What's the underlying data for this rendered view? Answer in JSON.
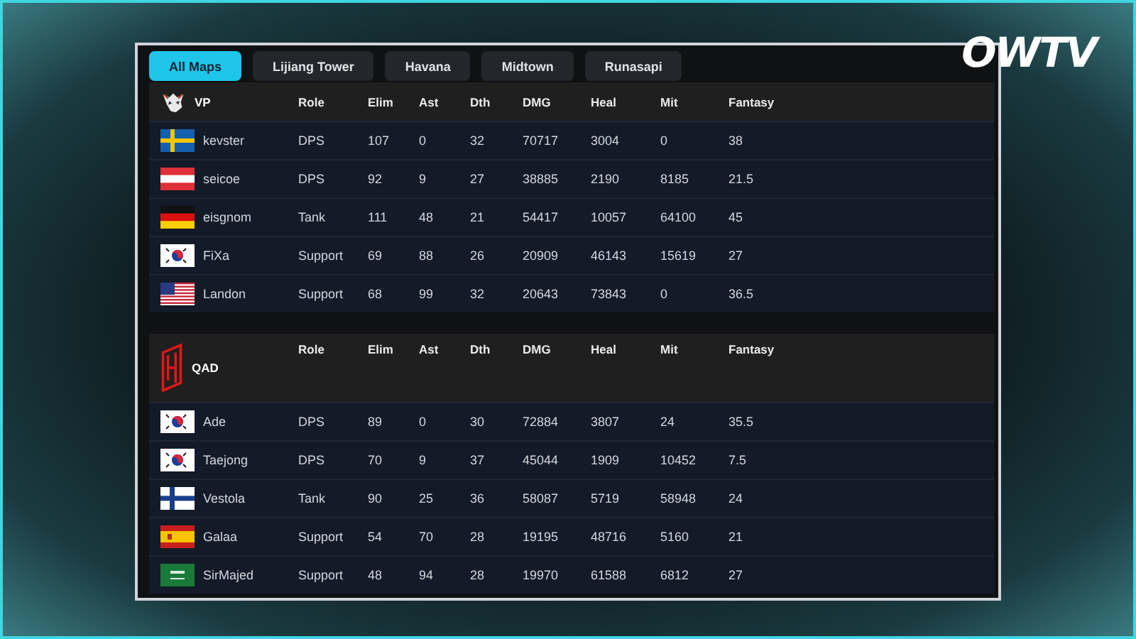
{
  "logo": {
    "text": "OWTV"
  },
  "tabs": [
    {
      "label": "All Maps",
      "selected": true
    },
    {
      "label": "Lijiang Tower",
      "selected": false
    },
    {
      "label": "Havana",
      "selected": false
    },
    {
      "label": "Midtown",
      "selected": false
    },
    {
      "label": "Runasapi",
      "selected": false
    }
  ],
  "teams": [
    {
      "name": "VP",
      "kind": "vp",
      "columns": [
        "Role",
        "Elim",
        "Ast",
        "Dth",
        "DMG",
        "Heal",
        "Mit",
        "Fantasy"
      ],
      "players": [
        {
          "kind": "se",
          "name": "kevster",
          "stats": [
            "DPS",
            "107",
            "0",
            "32",
            "70717",
            "3004",
            "0",
            "38"
          ]
        },
        {
          "kind": "at",
          "name": "seicoe",
          "stats": [
            "DPS",
            "92",
            "9",
            "27",
            "38885",
            "2190",
            "8185",
            "21.5"
          ]
        },
        {
          "kind": "de",
          "name": "eisgnom",
          "stats": [
            "Tank",
            "111",
            "48",
            "21",
            "54417",
            "10057",
            "64100",
            "45"
          ]
        },
        {
          "kind": "kr",
          "name": "FiXa",
          "stats": [
            "Support",
            "69",
            "88",
            "26",
            "20909",
            "46143",
            "15619",
            "27"
          ]
        },
        {
          "kind": "us",
          "name": "Landon",
          "stats": [
            "Support",
            "68",
            "99",
            "32",
            "20643",
            "73843",
            "0",
            "36.5"
          ]
        }
      ]
    },
    {
      "name": "QAD",
      "kind": "qad",
      "columns": [
        "Role",
        "Elim",
        "Ast",
        "Dth",
        "DMG",
        "Heal",
        "Mit",
        "Fantasy"
      ],
      "players": [
        {
          "kind": "kr",
          "name": "Ade",
          "stats": [
            "DPS",
            "89",
            "0",
            "30",
            "72884",
            "3807",
            "24",
            "35.5"
          ]
        },
        {
          "kind": "kr",
          "name": "Taejong",
          "stats": [
            "DPS",
            "70",
            "9",
            "37",
            "45044",
            "1909",
            "10452",
            "7.5"
          ]
        },
        {
          "kind": "fi",
          "name": "Vestola",
          "stats": [
            "Tank",
            "90",
            "25",
            "36",
            "58087",
            "5719",
            "58948",
            "24"
          ]
        },
        {
          "kind": "es",
          "name": "Galaa",
          "stats": [
            "Support",
            "54",
            "70",
            "28",
            "19195",
            "48716",
            "5160",
            "21"
          ]
        },
        {
          "kind": "sa",
          "name": "SirMajed",
          "stats": [
            "Support",
            "48",
            "94",
            "28",
            "19970",
            "61588",
            "6812",
            "27"
          ]
        }
      ]
    }
  ]
}
